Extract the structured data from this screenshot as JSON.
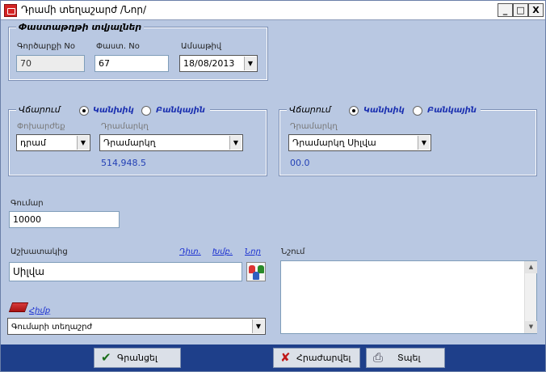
{
  "window": {
    "title": "Դրամի տեղաշարժ /Նոր/",
    "min_label": "_",
    "max_label": "□",
    "close_label": "X"
  },
  "doc": {
    "group_title": "Փաստաթղթի տվյալներ",
    "number_label": "Գործարքի No",
    "number_value": "70",
    "doc_no_label": "Փաստ. No",
    "doc_no_value": "67",
    "date_label": "Ամսաթիվ",
    "date_value": "18/08/2013"
  },
  "outgoing": {
    "title": "Վճարում",
    "radio_cash": "Կանխիկ",
    "radio_bank": "Բանկային",
    "currency_label": "Փոխարժեք",
    "currency_value": "դրամ",
    "cashbox_label": "Դրամարկղ",
    "cashbox_value": "Դրամարկղ",
    "balance": "514,948.5"
  },
  "incoming": {
    "title": "Վճարում",
    "radio_cash": "Կանխիկ",
    "radio_bank": "Բանկային",
    "cashbox_label": "Դրամարկղ",
    "cashbox_value": "Դրամարկղ Սիլվա",
    "balance": "00.0"
  },
  "amount": {
    "label": "Գումար",
    "value": "10000"
  },
  "employee": {
    "label": "Աշխատակից",
    "value": "Սիլվա",
    "link_view": "Դիտ.",
    "link_edit": "Խմբ.",
    "link_new": "Նոր"
  },
  "note": {
    "label": "Նշում"
  },
  "category": {
    "link": "Հիմք",
    "value": "Գումարի տեղաշրժ"
  },
  "actions": {
    "save": "Գրանցել",
    "cancel": "Հրաժարվել",
    "print": "Տպել"
  },
  "colors": {
    "window_bg": "#b9c8e2",
    "bottom_bar": "#1e3f8a",
    "radio_label": "#1a2fb0",
    "amount_text": "#2340b5"
  }
}
